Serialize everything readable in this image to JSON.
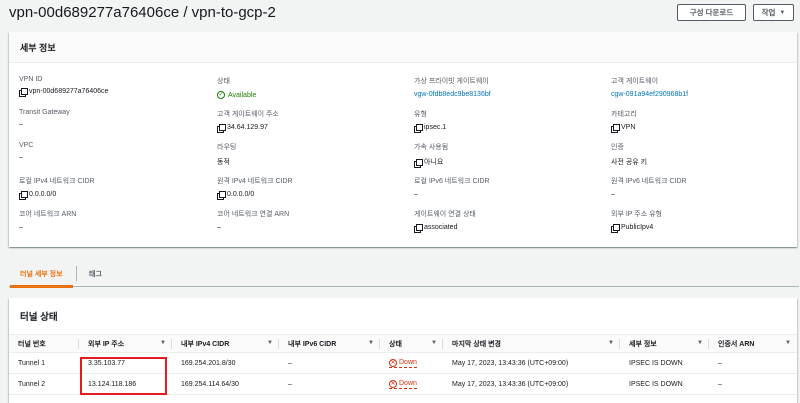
{
  "header": {
    "title": "vpn-00d689277a76406ce / vpn-to-gcp-2",
    "download_label": "구성 다운로드",
    "actions_label": "작업"
  },
  "details": {
    "heading": "세부 정보",
    "fields": {
      "vpn_id": {
        "label": "VPN ID",
        "value": "vpn-00d689277a76406ce"
      },
      "state": {
        "label": "상태",
        "value": "Available"
      },
      "vgw": {
        "label": "가상 프라이빗 게이트웨이",
        "value": "vgw-0fdb8edc9be8136bf"
      },
      "cgw": {
        "label": "고객 게이트웨이",
        "value": "cgw-091a94ef290968b1f"
      },
      "tgw": {
        "label": "Transit Gateway",
        "value": "–"
      },
      "cgw_address": {
        "label": "고객 게이트웨이 주소",
        "value": "34.64.129.97"
      },
      "type": {
        "label": "유형",
        "value": "ipsec.1"
      },
      "category": {
        "label": "카테고리",
        "value": "VPN"
      },
      "vpc": {
        "label": "VPC",
        "value": "–"
      },
      "routing": {
        "label": "라우팅",
        "value": "동적"
      },
      "acceleration": {
        "label": "가속 사용됨",
        "value": "아니요"
      },
      "auth": {
        "label": "인증",
        "value": "사전 공유 키"
      },
      "local_ipv4": {
        "label": "로컬 IPv4 네트워크 CIDR",
        "value": "0.0.0.0/0"
      },
      "remote_ipv4": {
        "label": "원격 IPv4 네트워크 CIDR",
        "value": "0.0.0.0/0"
      },
      "local_ipv6": {
        "label": "로컬 IPv6 네트워크 CIDR",
        "value": "–"
      },
      "remote_ipv6": {
        "label": "원격 IPv6 네트워크 CIDR",
        "value": "–"
      },
      "core_arn": {
        "label": "코어 네트워크 ARN",
        "value": "–"
      },
      "core_attach_arn": {
        "label": "코어 네트워크 연결 ARN",
        "value": "–"
      },
      "gw_assoc_state": {
        "label": "게이트웨이 연결 상태",
        "value": "associated"
      },
      "outside_ip_type": {
        "label": "외부 IP 주소 유형",
        "value": "PublicIpv4"
      }
    }
  },
  "tabs": [
    {
      "label": "터널 세부 정보"
    },
    {
      "label": "태그"
    }
  ],
  "tunnels": {
    "heading": "터널 상태",
    "columns": [
      "터널 번호",
      "외부 IP 주소",
      "내부 IPv4 CIDR",
      "내부 IPv6 CIDR",
      "상태",
      "마지막 상태 변경",
      "세부 정보",
      "인증서 ARN"
    ],
    "rows": [
      {
        "number": "Tunnel 1",
        "outside_ip": "3.35.103.77",
        "inside_ipv4": "169.254.201.8/30",
        "inside_ipv6": "–",
        "status": "Down",
        "last_change": "May 17, 2023, 13:43:36 (UTC+09:00)",
        "details": "IPSEC IS DOWN",
        "cert_arn": "–"
      },
      {
        "number": "Tunnel 2",
        "outside_ip": "13.124.118.186",
        "inside_ipv4": "169.254.114.64/30",
        "inside_ipv6": "–",
        "status": "Down",
        "last_change": "May 17, 2023, 13:43:36 (UTC+09:00)",
        "details": "IPSEC IS DOWN",
        "cert_arn": "–"
      }
    ]
  },
  "colors": {
    "link": "#0073bb",
    "available": "#1d8102",
    "down": "#d13212",
    "tab_active": "#ec7211",
    "highlight": "#e31b23"
  }
}
